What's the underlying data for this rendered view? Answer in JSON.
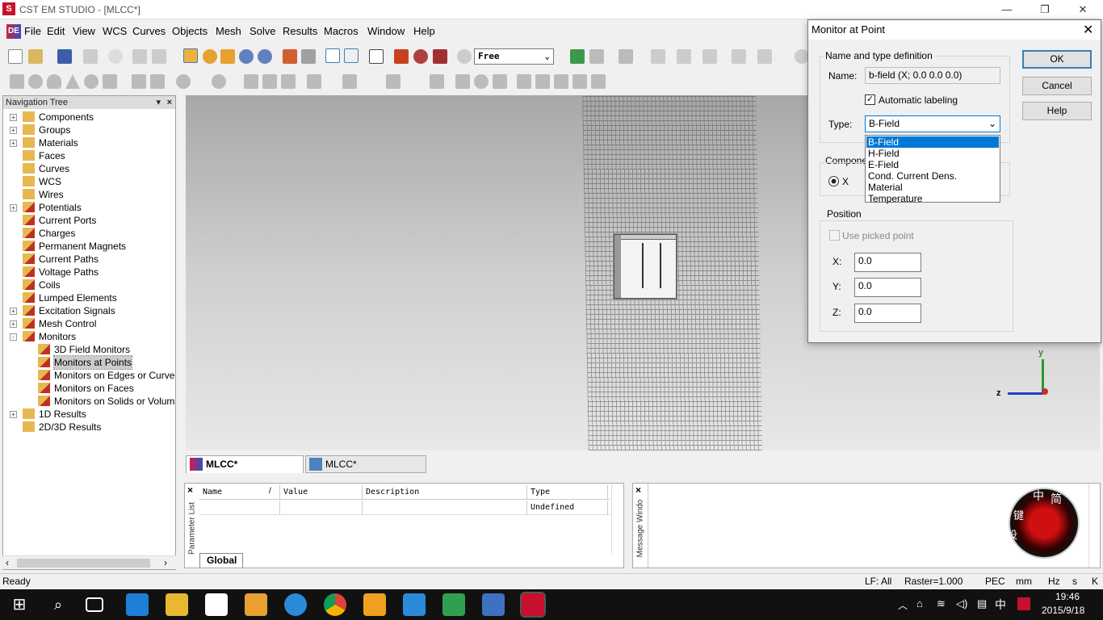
{
  "window": {
    "title": "CST EM STUDIO - [MLCC*]",
    "minimize": "—",
    "restore": "❐",
    "close": "✕"
  },
  "menu": [
    "File",
    "Edit",
    "View",
    "WCS",
    "Curves",
    "Objects",
    "Mesh",
    "Solve",
    "Results",
    "Macros",
    "Window",
    "Help"
  ],
  "toolbar": {
    "mode_select": "Free"
  },
  "nav_tree": {
    "title": "Navigation Tree",
    "items": [
      {
        "label": "Components",
        "level": 0,
        "expander": "+"
      },
      {
        "label": "Groups",
        "level": 0,
        "expander": "+"
      },
      {
        "label": "Materials",
        "level": 0,
        "expander": "+"
      },
      {
        "label": "Faces",
        "level": 0,
        "expander": ""
      },
      {
        "label": "Curves",
        "level": 0,
        "expander": ""
      },
      {
        "label": "WCS",
        "level": 0,
        "expander": ""
      },
      {
        "label": "Wires",
        "level": 0,
        "expander": ""
      },
      {
        "label": "Potentials",
        "level": 0,
        "expander": "+"
      },
      {
        "label": "Current Ports",
        "level": 0,
        "expander": ""
      },
      {
        "label": "Charges",
        "level": 0,
        "expander": ""
      },
      {
        "label": "Permanent Magnets",
        "level": 0,
        "expander": ""
      },
      {
        "label": "Current Paths",
        "level": 0,
        "expander": ""
      },
      {
        "label": "Voltage Paths",
        "level": 0,
        "expander": ""
      },
      {
        "label": "Coils",
        "level": 0,
        "expander": ""
      },
      {
        "label": "Lumped Elements",
        "level": 0,
        "expander": ""
      },
      {
        "label": "Excitation Signals",
        "level": 0,
        "expander": "+"
      },
      {
        "label": "Mesh Control",
        "level": 0,
        "expander": "+"
      },
      {
        "label": "Monitors",
        "level": 0,
        "expander": "-"
      },
      {
        "label": "3D Field Monitors",
        "level": 1,
        "expander": ""
      },
      {
        "label": "Monitors at Points",
        "level": 1,
        "expander": "",
        "selected": true
      },
      {
        "label": "Monitors on Edges or Curve",
        "level": 1,
        "expander": ""
      },
      {
        "label": "Monitors on Faces",
        "level": 1,
        "expander": ""
      },
      {
        "label": "Monitors on Solids or Volum",
        "level": 1,
        "expander": ""
      },
      {
        "label": "1D Results",
        "level": 0,
        "expander": "+"
      },
      {
        "label": "2D/3D Results",
        "level": 0,
        "expander": ""
      }
    ]
  },
  "view_tabs": [
    "MLCC*",
    "MLCC*"
  ],
  "axes": {
    "y": "y",
    "z": "z"
  },
  "param_list": {
    "side_label": "Parameter List",
    "columns": [
      "Name",
      "/",
      "Value",
      "Description",
      "Type"
    ],
    "row_type": "Undefined",
    "tab": "Global"
  },
  "message_window": {
    "side_label": "Message Windo"
  },
  "ime": {
    "mid": "中",
    "simp": "简",
    "key": "键",
    "set": "设"
  },
  "status": {
    "left": "Ready",
    "lf": "LF: All",
    "raster": "Raster=1.000",
    "pec": "PEC",
    "mm": "mm",
    "hz": "Hz",
    "s": "s",
    "k": "K"
  },
  "taskbar": {
    "time": "19:46",
    "date": "2015/9/18",
    "ime": "中"
  },
  "dialog": {
    "title": "Monitor at Point",
    "group_name": "Name and type definition",
    "name_label": "Name:",
    "name_value": "b-field (X; 0.0 0.0 0.0)",
    "auto_label": "Automatic labeling",
    "type_label": "Type:",
    "type_value": "B-Field",
    "type_options": [
      "B-Field",
      "H-Field",
      "E-Field",
      "Cond. Current Dens.",
      "Material",
      "Temperature"
    ],
    "component_label": "Compone",
    "component_x": "X",
    "position_group": "Position",
    "use_picked": "Use picked point",
    "x_label": "X:",
    "x_value": "0.0",
    "y_label": "Y:",
    "y_value": "0.0",
    "z_label": "Z:",
    "z_value": "0.0",
    "ok": "OK",
    "cancel": "Cancel",
    "help": "Help"
  }
}
